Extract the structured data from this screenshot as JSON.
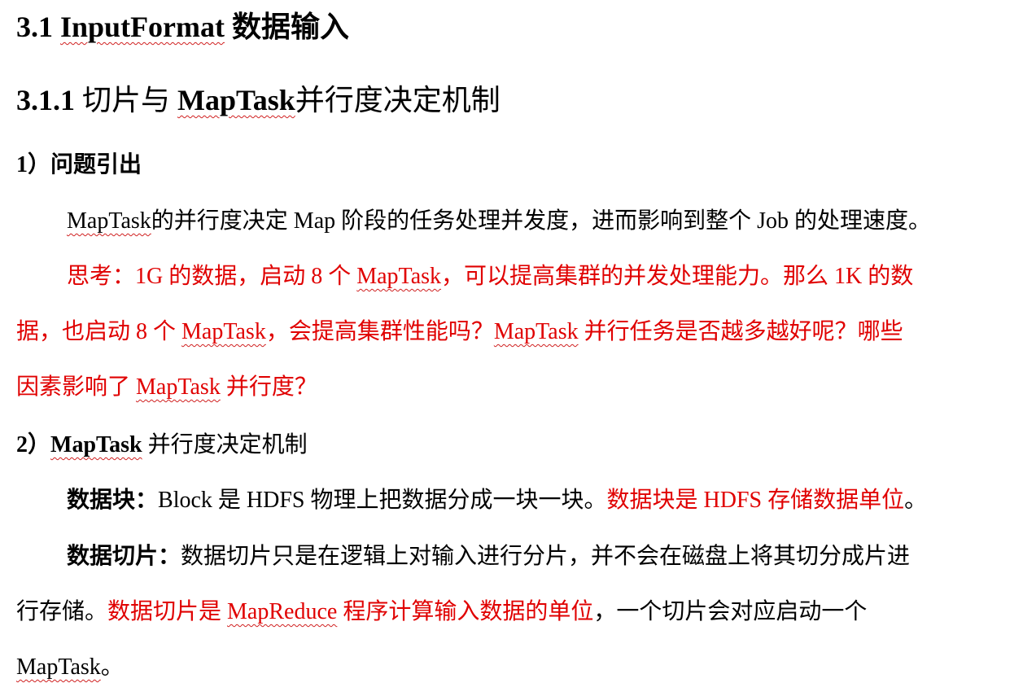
{
  "heading1": {
    "number": "3.1",
    "term": "InputFormat",
    "rest": "数据输入"
  },
  "heading2": {
    "number": "3.1.1",
    "pre": "切片与",
    "term": "MapTask",
    "rest": "并行度决定机制"
  },
  "section1": {
    "title": "1）问题引出",
    "para1": {
      "term": "MapTask",
      "text": "的并行度决定 Map 阶段的任务处理并发度，进而影响到整个 Job 的处理速度。"
    },
    "para2": {
      "l1_a": "思考：1G 的数据，启动 8 个",
      "l1_term": "MapTask",
      "l1_b": "，可以提高集群的并发处理能力。那么 1K 的数",
      "l2_a": "据，也启动 8 个",
      "l2_term1": "MapTask",
      "l2_b": "，会提高集群性能吗？",
      "l2_term2": "MapTask",
      "l2_c": "并行任务是否越多越好呢？哪些",
      "l3_a": "因素影响了",
      "l3_term": "MapTask",
      "l3_b": "并行度？"
    }
  },
  "section2": {
    "title_prefix": "2）",
    "title_term": "MapTask",
    "title_rest": "并行度决定机制",
    "block": {
      "label": "数据块：",
      "text": "Block 是 HDFS 物理上把数据分成一块一块。",
      "red": "数据块是 HDFS 存储数据单位",
      "end": "。"
    },
    "split": {
      "label": "数据切片：",
      "l1": "数据切片只是在逻辑上对输入进行分片，并不会在磁盘上将其切分成片进",
      "l2_a": "行存储。",
      "l2_red_a": "数据切片是",
      "l2_red_term": "MapReduce",
      "l2_red_b": "程序计算输入数据的单位",
      "l2_b": "，一个切片会对应启动一个",
      "l3_term": "MapTask",
      "l3_end": "。"
    }
  }
}
